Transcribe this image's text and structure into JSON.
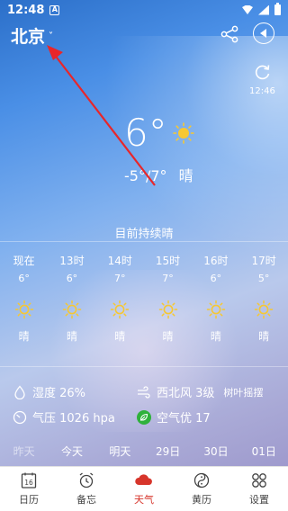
{
  "status_bar": {
    "time": "12:48",
    "notification_glyph": "A"
  },
  "header": {
    "city": "北京",
    "city_chevron": "˅",
    "share_icon": "share-icon",
    "sound_icon": "speaker-icon"
  },
  "refresh": {
    "time": "12:46"
  },
  "current": {
    "temp": "6°",
    "range": "-5°/7°",
    "condition": "晴"
  },
  "trend": {
    "text": "目前持续晴"
  },
  "hourly": [
    {
      "label": "现在",
      "temp": "6°",
      "cond": "晴"
    },
    {
      "label": "13时",
      "temp": "6°",
      "cond": "晴"
    },
    {
      "label": "14时",
      "temp": "7°",
      "cond": "晴"
    },
    {
      "label": "15时",
      "temp": "7°",
      "cond": "晴"
    },
    {
      "label": "16时",
      "temp": "6°",
      "cond": "晴"
    },
    {
      "label": "17时",
      "temp": "5°",
      "cond": "晴"
    }
  ],
  "details": {
    "humidity": "湿度 26%",
    "wind": "西北风 3级",
    "wind_desc": "树叶摇摆",
    "pressure": "气压 1026 hpa",
    "air": "空气优 17"
  },
  "days": [
    {
      "label": "昨天",
      "past": true
    },
    {
      "label": "今天",
      "past": false
    },
    {
      "label": "明天",
      "past": false
    },
    {
      "label": "29日",
      "past": false
    },
    {
      "label": "30日",
      "past": false
    },
    {
      "label": "01日",
      "past": false
    }
  ],
  "tabs": [
    {
      "label": "日历",
      "icon": "calendar-icon",
      "badge": "16"
    },
    {
      "label": "备忘",
      "icon": "alarm-clock-icon"
    },
    {
      "label": "天气",
      "icon": "cloud-icon",
      "active": true
    },
    {
      "label": "黄历",
      "icon": "yin-yang-icon"
    },
    {
      "label": "设置",
      "icon": "settings-grid-icon"
    }
  ],
  "colors": {
    "accent": "#d7352b",
    "sun": "#f6c833",
    "air_good": "#2fb13b"
  }
}
